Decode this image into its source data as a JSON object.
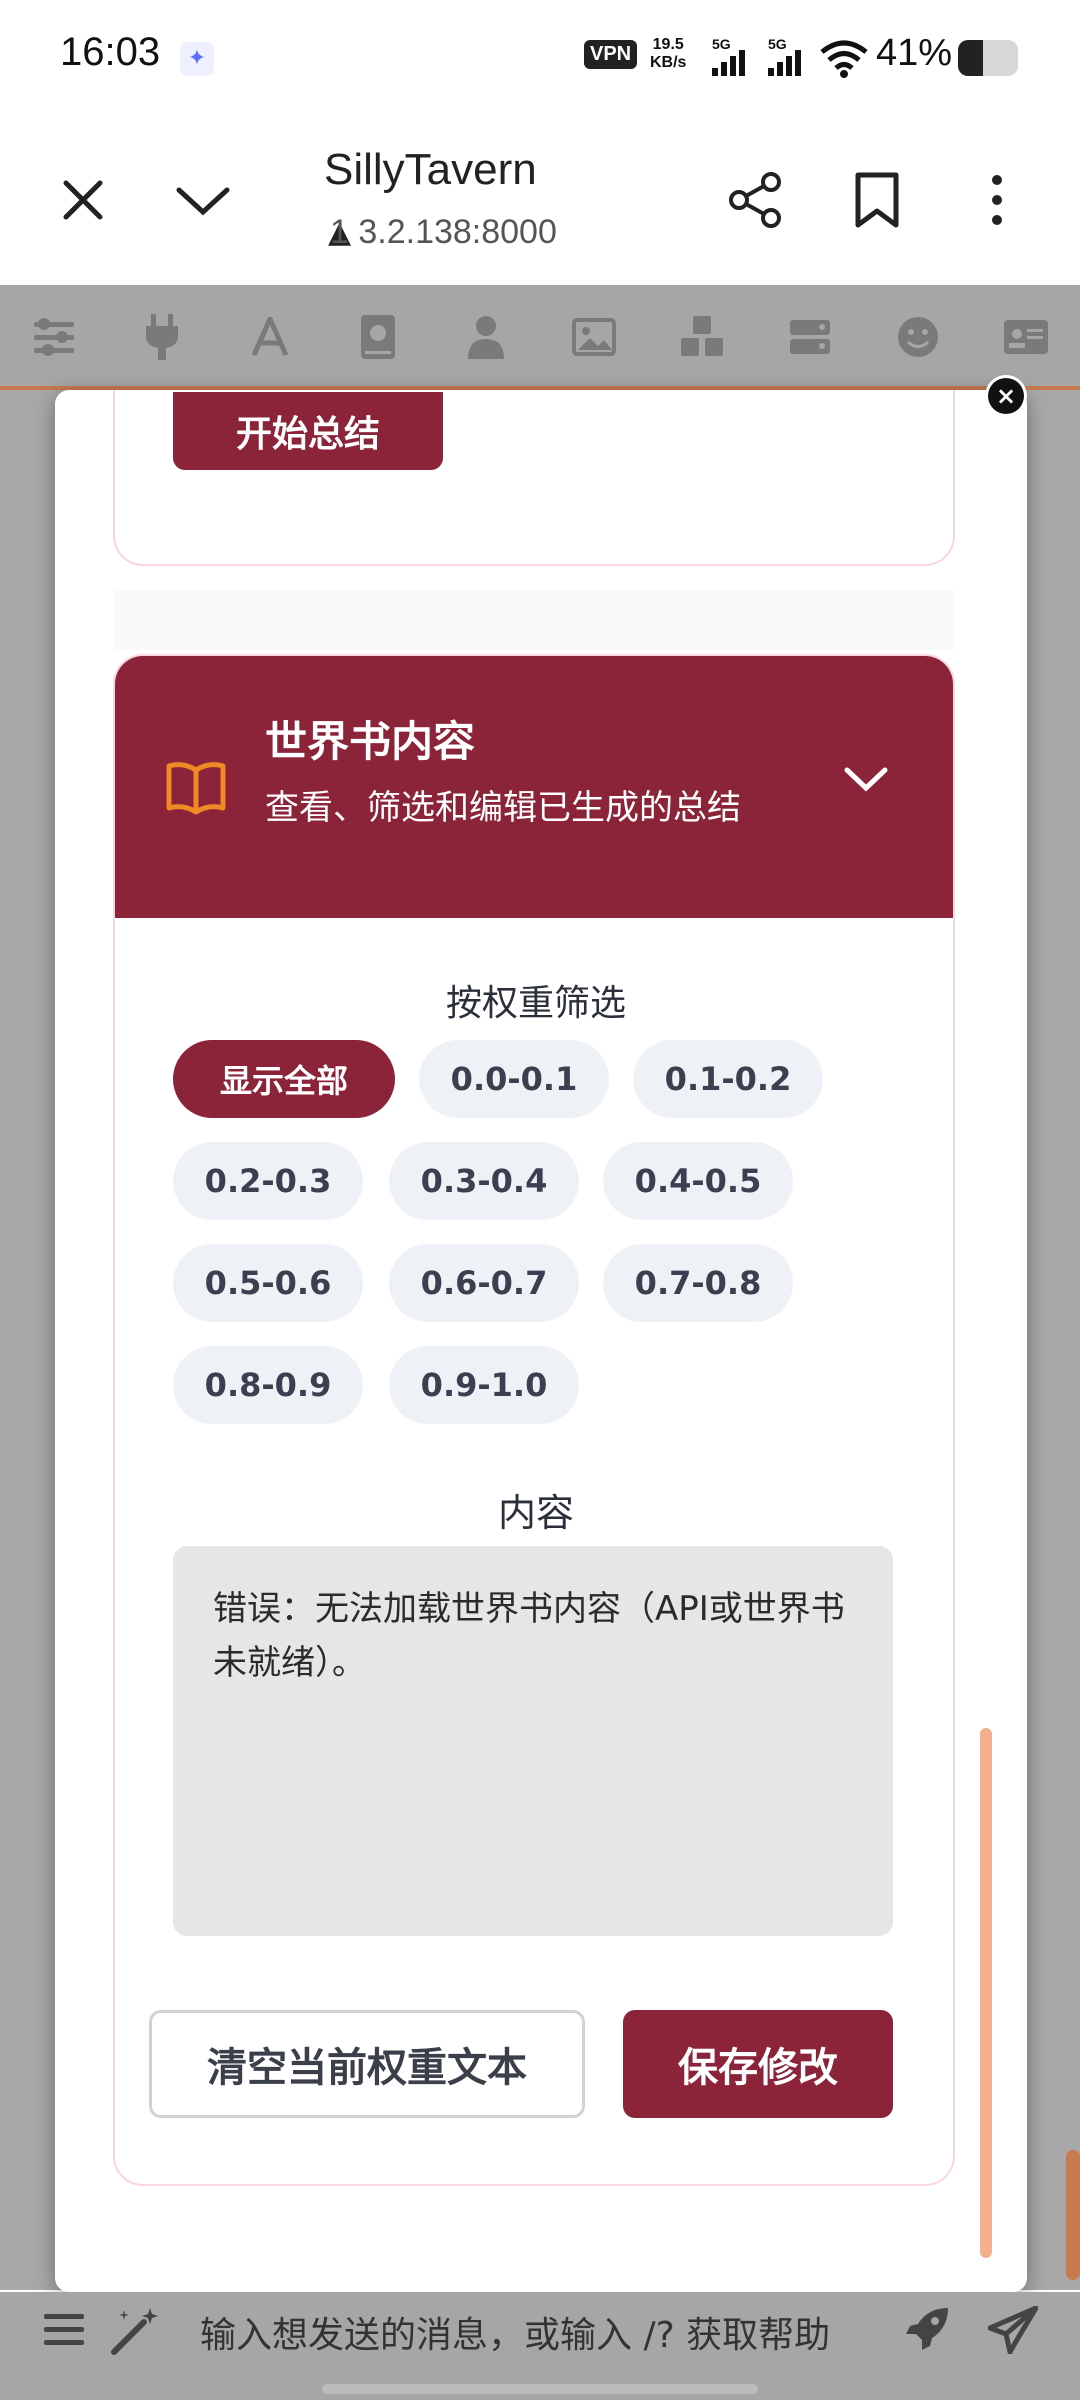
{
  "status_bar": {
    "time": "16:03",
    "vpn": "VPN",
    "speed_value": "19.5",
    "speed_unit": "KB/s",
    "sig1": "5G",
    "sig2": "5G",
    "battery": "41%"
  },
  "browser": {
    "title": "SillyTavern",
    "url": "1 3.2.138:8000",
    "icons": [
      "close-icon",
      "chevron-down-icon",
      "share-icon",
      "bookmark-icon",
      "more-vert-icon"
    ]
  },
  "toolbar": {
    "icons": [
      "sliders-icon",
      "plug-icon",
      "font-icon",
      "book-icon",
      "user-icon",
      "image-icon",
      "cubes-icon",
      "server-icon",
      "smile-icon",
      "id-card-icon"
    ]
  },
  "modal": {
    "close_label": "×",
    "start_summary_button": "开始总结",
    "worldbook": {
      "title": "世界书内容",
      "subtitle": "查看、筛选和编辑已生成的总结",
      "filter_title": "按权重筛选",
      "chips": [
        "显示全部",
        "0.0-0.1",
        "0.1-0.2",
        "0.2-0.3",
        "0.3-0.4",
        "0.4-0.5",
        "0.5-0.6",
        "0.6-0.7",
        "0.7-0.8",
        "0.8-0.9",
        "0.9-1.0"
      ],
      "active_chip": "显示全部",
      "content_title": "内容",
      "content_text": "错误：无法加载世界书内容（API或世界书未就绪）。",
      "clear_button": "清空当前权重文本",
      "save_button": "保存修改"
    }
  },
  "input_bar": {
    "placeholder": "输入想发送的消息，或输入 /? 获取帮助"
  },
  "colors": {
    "accent": "#8b2439",
    "orange": "#f08a24",
    "chip_bg": "#eef1f6"
  }
}
